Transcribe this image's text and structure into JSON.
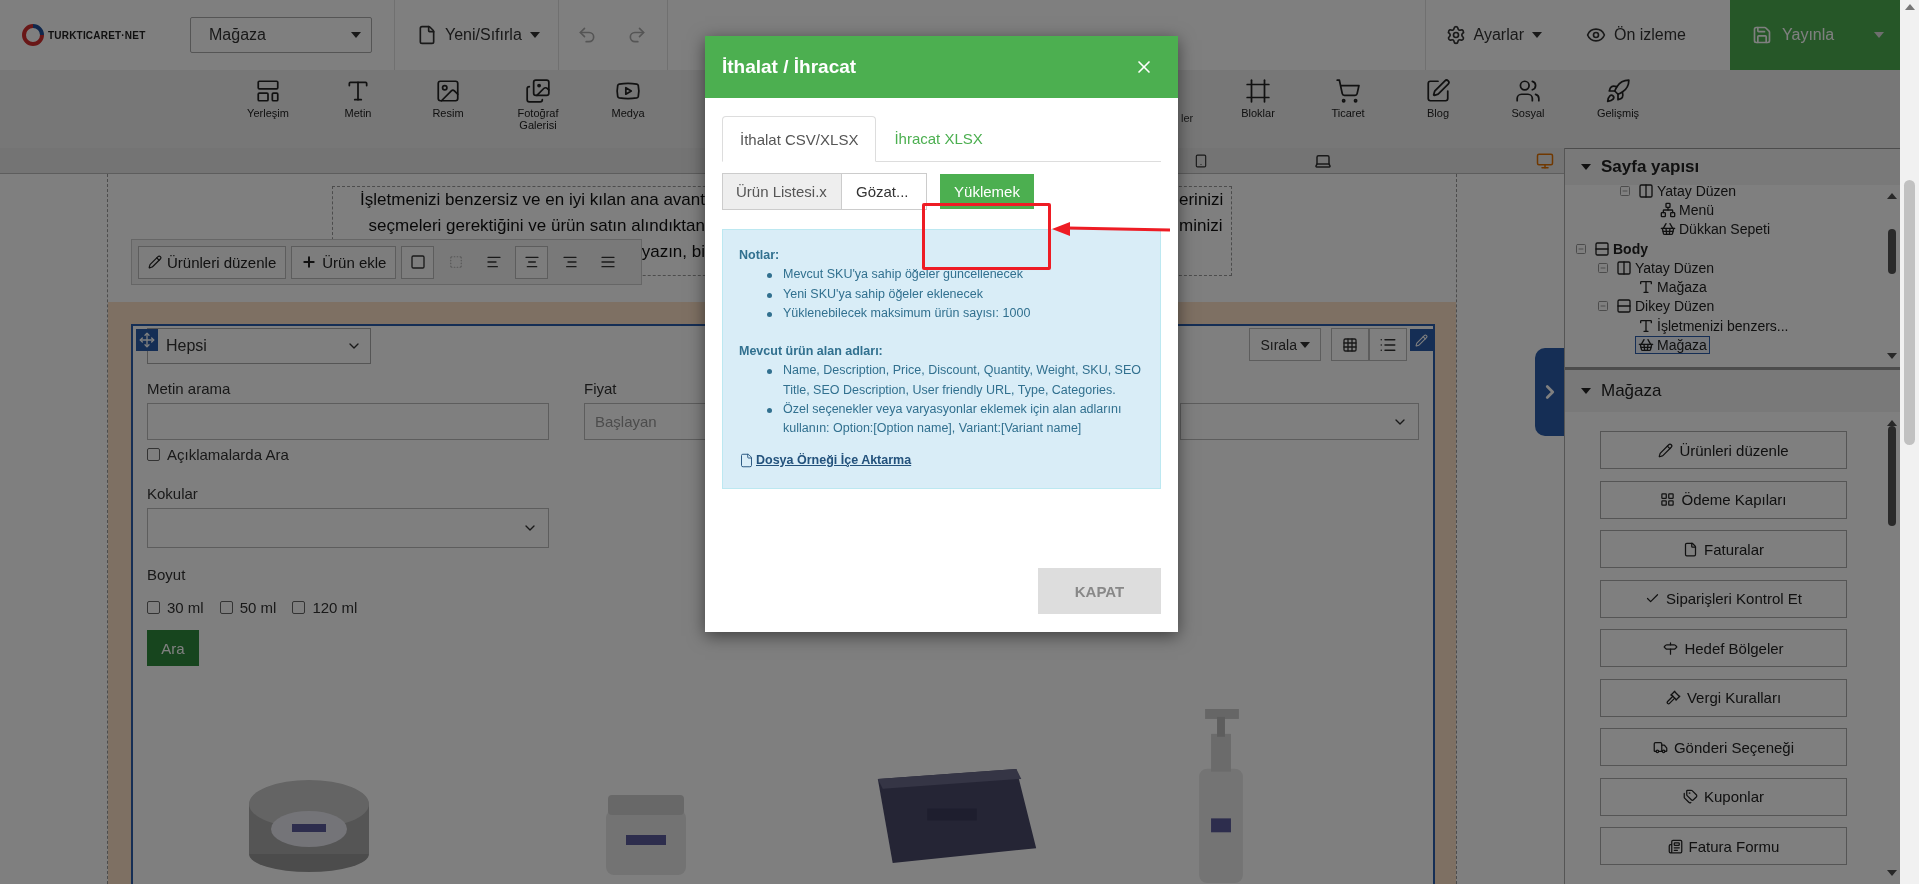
{
  "topbar": {
    "logo": "TURKTICARET·NET",
    "page_select": "Mağaza",
    "new_reset": "Yeni/Sıfırla",
    "settings": "Ayarlar",
    "preview": "Ön izleme",
    "publish": "Yayınla"
  },
  "toolbar": [
    {
      "label": "Yerleşim",
      "kind": "full"
    },
    {
      "label": "Metin",
      "kind": "full"
    },
    {
      "label": "Resim",
      "kind": "full"
    },
    {
      "label": "Fotoğraf Galerisi",
      "kind": "full"
    },
    {
      "label": "Medya",
      "kind": "full"
    },
    {
      "label": "ler",
      "kind": "partial"
    },
    {
      "label": "Bloklar",
      "kind": "full"
    },
    {
      "label": "Ticaret",
      "kind": "full"
    },
    {
      "label": "Blog",
      "kind": "full"
    },
    {
      "label": "Sosyal",
      "kind": "full"
    },
    {
      "label": "Gelişmiş",
      "kind": "full"
    }
  ],
  "canvas": {
    "intro_lines": [
      {
        "left": "İşletmenizi benzersiz ve en iyi kılan ana avant",
        "right": "erinizi"
      },
      {
        "left": "seçmeleri gerektiğini ve ürün satın alındıktan",
        "right": "minizi"
      },
      {
        "left": "yazın, bi"
      }
    ],
    "element_toolbar": {
      "edit": "Ürünleri düzenle",
      "add": "Ürün ekle"
    },
    "store": {
      "category": "Hepsi",
      "sort": "Sırala",
      "search_label": "Metin arama",
      "price_label": "Fiyat",
      "price_from_placeholder": "Başlayan",
      "search_in_desc": {
        "label": "Açıklamalarda Ara",
        "checked": false
      },
      "scents_label": "Kokular",
      "size_label": "Boyut",
      "sizes": [
        {
          "label": "30 ml",
          "checked": false
        },
        {
          "label": "50 ml",
          "checked": false
        },
        {
          "label": "120 ml",
          "checked": false
        }
      ],
      "search_button": "Ara"
    }
  },
  "modal": {
    "title": "İthalat / İhracat",
    "tabs": [
      {
        "label": "İthalat CSV/XLSX",
        "selected": true
      },
      {
        "label": "İhracat XLSX",
        "selected": false
      }
    ],
    "file_name": "Ürün Listesi.x",
    "browse": "Gözat...",
    "upload": "Yüklemek",
    "notes_title": "Notlar:",
    "notes": [
      "Mevcut SKU'ya sahip öğeler güncellenecek",
      "Yeni SKU'ya sahip öğeler eklenecek",
      "Yüklenebilecek maksimum ürün sayısı: 1000"
    ],
    "fields_title": "Mevcut ürün alan adları:",
    "fields": [
      "Name, Description, Price, Discount, Quantity, Weight, SKU, SEO Title, SEO Description, User friendly URL, Type, Categories.",
      "Özel seçenekler veya varyasyonlar eklemek için alan adlarını kullanın: Option:[Option name], Variant:[Variant name]"
    ],
    "sample_link": "Dosya Örneği İçe Aktarma",
    "close": "KAPAT"
  },
  "right_panel": {
    "structure_title": "Sayfa yapısı",
    "tree": [
      {
        "children": [
          {
            "children": [
              {
                "label": "Yatay Düzen",
                "kind": "columns",
                "expanded": true,
                "selected": false,
                "children": [
                  {
                    "label": "Menü",
                    "kind": "sitemap",
                    "selected": false
                  },
                  {
                    "label": "Dükkan Sepeti",
                    "kind": "basket",
                    "selected": false
                  }
                ]
              }
            ]
          }
        ]
      },
      {
        "label": "Body",
        "kind": "rows",
        "expanded": true,
        "selected": false,
        "children": [
          {
            "label": "Yatay Düzen",
            "kind": "columns",
            "expanded": true,
            "selected": false,
            "children": [
              {
                "label": "Mağaza",
                "kind": "text",
                "selected": false
              }
            ]
          },
          {
            "label": "Dikey Düzen",
            "kind": "rows",
            "expanded": true,
            "selected": false,
            "children": [
              {
                "label": "İşletmenizi benzers...",
                "kind": "text",
                "selected": false
              },
              {
                "label": "Mağaza",
                "kind": "basket",
                "selected": true
              }
            ]
          }
        ]
      }
    ],
    "store_title": "Mağaza",
    "actions": [
      "Ürünleri düzenle",
      "Ödeme Kapıları",
      "Faturalar",
      "Siparişleri Kontrol Et",
      "Hedef Bölgeler",
      "Vergi Kuralları",
      "Gönderi Seçeneği",
      "Kuponlar",
      "Fatura Formu"
    ]
  }
}
